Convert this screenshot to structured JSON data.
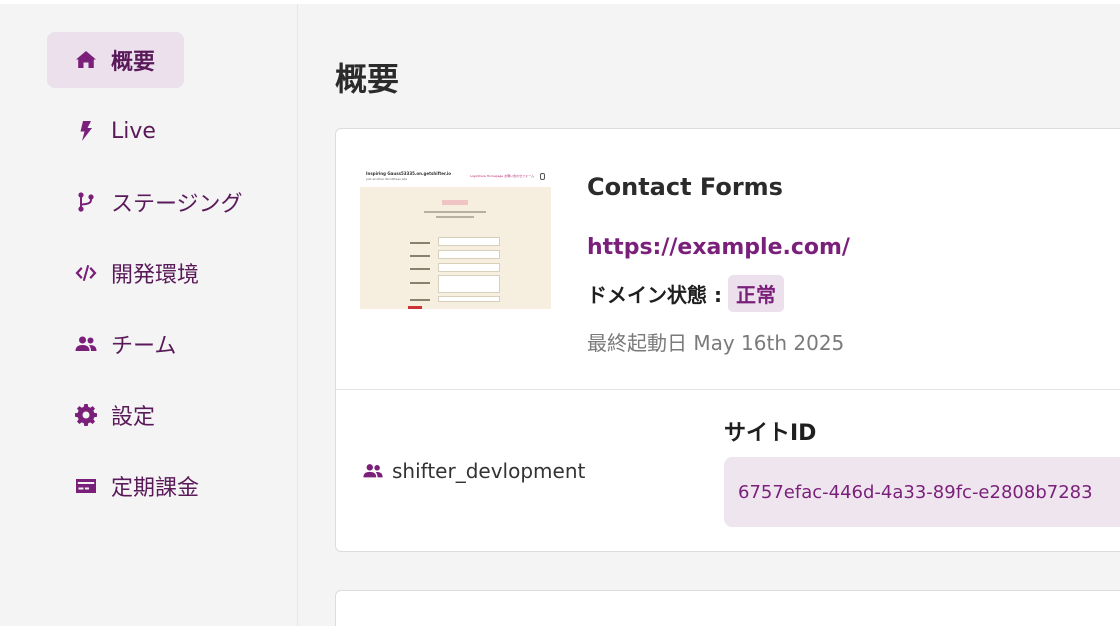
{
  "sidebar": {
    "items": [
      {
        "label": "概要",
        "icon": "home-icon",
        "active": true
      },
      {
        "label": "Live",
        "icon": "bolt-icon",
        "active": false
      },
      {
        "label": "ステージング",
        "icon": "branch-icon",
        "active": false
      },
      {
        "label": "開発環境",
        "icon": "code-icon",
        "active": false
      },
      {
        "label": "チーム",
        "icon": "users-icon",
        "active": false
      },
      {
        "label": "設定",
        "icon": "gear-icon",
        "active": false
      },
      {
        "label": "定期課金",
        "icon": "credit-card-icon",
        "active": false
      }
    ]
  },
  "main": {
    "title": "概要",
    "site": {
      "name": "Contact Forms",
      "url": "https://example.com/",
      "domain_label": "ドメイン状態 :",
      "domain_status": "正常",
      "last_launch": "最終起動日 May 16th 2025",
      "thumbnail": {
        "site_title": "Inspiring Gauss53335.on.getshifter.io",
        "tagline": "Just another WordPress site",
        "nav_text": "LogoShare  Homepage  お問い合わせフォーム"
      }
    },
    "team": {
      "name": "shifter_devlopment",
      "icon": "users-icon"
    },
    "site_id": {
      "label": "サイトID",
      "value": "6757efac-446d-4a33-89fc-e2808b7283"
    }
  },
  "colors": {
    "accent": "#7a1f7a",
    "accent_bg": "#ebe0eb",
    "background": "#f4f4f4"
  }
}
